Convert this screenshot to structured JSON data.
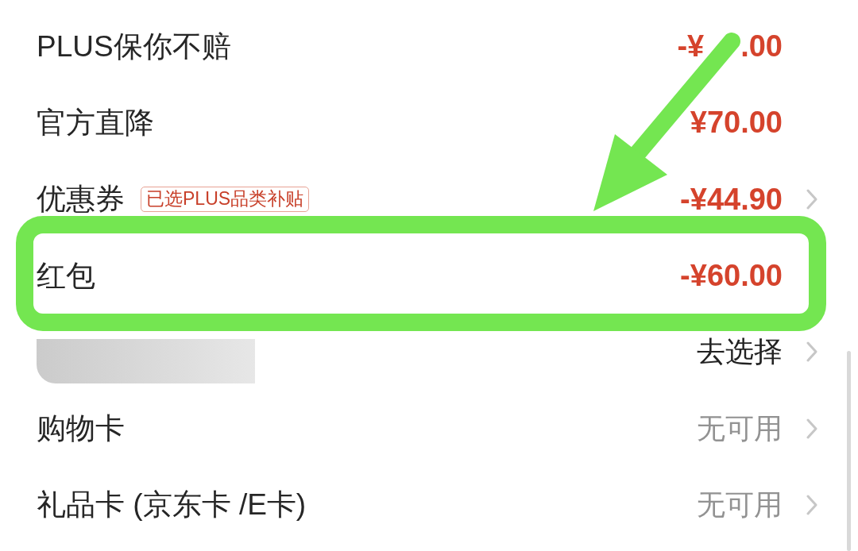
{
  "rows": [
    {
      "label": "PLUS保你不赔",
      "value": "-¥",
      "value_tail": ".00",
      "kind": "discount",
      "chevron": false,
      "highlighted": false
    },
    {
      "label": "官方直降",
      "value": "¥70.00",
      "kind": "discount",
      "chevron": false,
      "highlighted": false
    },
    {
      "label": "优惠券",
      "badge": "已选PLUS品类补贴",
      "value": "-¥44.90",
      "kind": "discount",
      "chevron": true,
      "highlighted": false
    },
    {
      "label": "红包",
      "value": "-¥60.00",
      "kind": "discount",
      "chevron": false,
      "highlighted": true
    },
    {
      "blurred": true,
      "value": "去选择",
      "kind": "action",
      "chevron": true,
      "highlighted": false
    },
    {
      "label": "购物卡",
      "value": "无可用",
      "kind": "unavailable",
      "chevron": true,
      "highlighted": false
    },
    {
      "label": "礼品卡 (京东卡 /E卡)",
      "value": "无可用",
      "kind": "unavailable",
      "chevron": true,
      "highlighted": false
    }
  ]
}
